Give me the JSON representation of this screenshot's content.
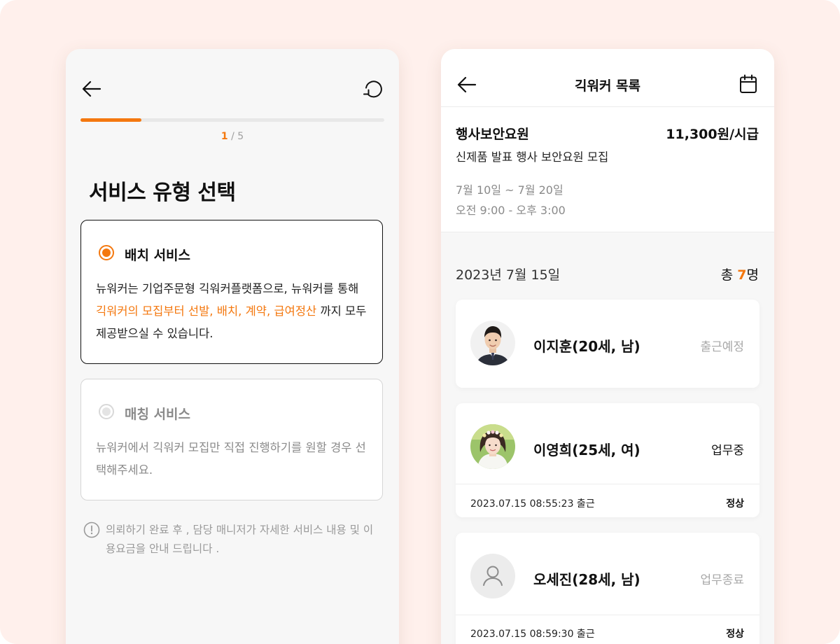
{
  "service_screen": {
    "step_current": "1",
    "step_total": "/ 5",
    "progress_fraction": 0.2,
    "title": "서비스 유형 선택",
    "options": [
      {
        "label": "배치 서비스",
        "selected": true,
        "desc_before": "뉴워커는 기업주문형 긱워커플랫폼으로, 뉴워커를 통해 ",
        "desc_highlight": "긱워커의 모집부터 선발, 배치, 계약, 급여정산",
        "desc_after": " 까지 모두 제공받으실 수 있습니다."
      },
      {
        "label": "매칭 서비스",
        "selected": false,
        "desc": "뉴워커에서 긱워커 모집만 직접 진행하기를 원할 경우 선택해주세요."
      }
    ],
    "notice": "의뢰하기  완료 후 , 담당 매니저가 자세한 서비스 내용 및 이용요금을 안내 드립니다 ."
  },
  "worker_list_screen": {
    "header_title": "긱워커 목록",
    "job": {
      "name": "행사보안요원",
      "wage": "11,300원/시급",
      "subtitle": "신제품 발표 행사 보안요원 모집",
      "date_range": "7월 10일 ~ 7월 20일",
      "time_range": "오전 9:00 - 오후 3:00"
    },
    "list_date": "2023년 7월 15일",
    "total_prefix": "총 ",
    "total_count": "7",
    "total_suffix": "명",
    "workers": [
      {
        "name": "이지훈(20세, 남)",
        "status": "출근예정"
      },
      {
        "name": "이영희(25세, 여)",
        "status": "업무중",
        "checkin": "2023.07.15 08:55:23 출근",
        "state": "정상"
      },
      {
        "name": "오세진(28세, 남)",
        "status": "업무종료",
        "checkin": "2023.07.15 08:59:30 출근",
        "state": "정상"
      }
    ]
  },
  "colors": {
    "accent": "#f4780f",
    "background": "#fff0ec",
    "panel": "#f7f7f7"
  },
  "icons": [
    "back-arrow-icon",
    "refresh-icon",
    "calendar-icon",
    "info-icon",
    "user-placeholder-icon"
  ]
}
